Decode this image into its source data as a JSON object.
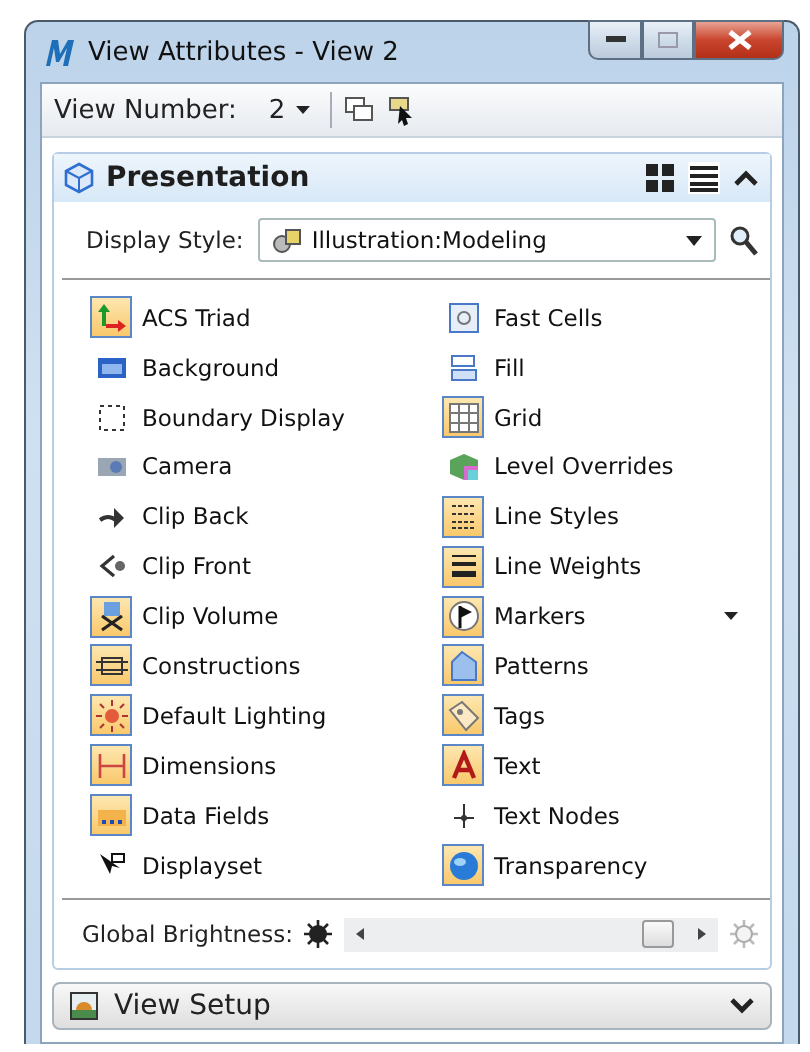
{
  "window": {
    "title": "View Attributes - View 2"
  },
  "toolbar": {
    "label": "View Number:",
    "value": "2"
  },
  "panel": {
    "title": "Presentation",
    "expanded": true
  },
  "display_style": {
    "label": "Display Style:",
    "value": "Illustration:Modeling"
  },
  "toggles": {
    "left": [
      {
        "label": "ACS Triad",
        "on": true
      },
      {
        "label": "Background",
        "on": false
      },
      {
        "label": "Boundary Display",
        "on": false
      },
      {
        "label": "Camera",
        "on": false
      },
      {
        "label": "Clip Back",
        "on": false
      },
      {
        "label": "Clip Front",
        "on": false
      },
      {
        "label": "Clip Volume",
        "on": true
      },
      {
        "label": "Constructions",
        "on": true
      },
      {
        "label": "Default Lighting",
        "on": true
      },
      {
        "label": "Dimensions",
        "on": true
      },
      {
        "label": "Data Fields",
        "on": true
      },
      {
        "label": "Displayset",
        "on": false
      }
    ],
    "right": [
      {
        "label": "Fast Cells",
        "on": false
      },
      {
        "label": "Fill",
        "on": false
      },
      {
        "label": "Grid",
        "on": true
      },
      {
        "label": "Level Overrides",
        "on": false
      },
      {
        "label": "Line Styles",
        "on": true
      },
      {
        "label": "Line Weights",
        "on": true
      },
      {
        "label": "Markers",
        "on": true,
        "dropdown": true
      },
      {
        "label": "Patterns",
        "on": true
      },
      {
        "label": "Tags",
        "on": true
      },
      {
        "label": "Text",
        "on": true
      },
      {
        "label": "Text Nodes",
        "on": false
      },
      {
        "label": "Transparency",
        "on": true
      }
    ]
  },
  "brightness": {
    "label": "Global Brightness:",
    "level": 0.92
  },
  "collapsed_panel": {
    "title": "View Setup",
    "expanded": false
  }
}
